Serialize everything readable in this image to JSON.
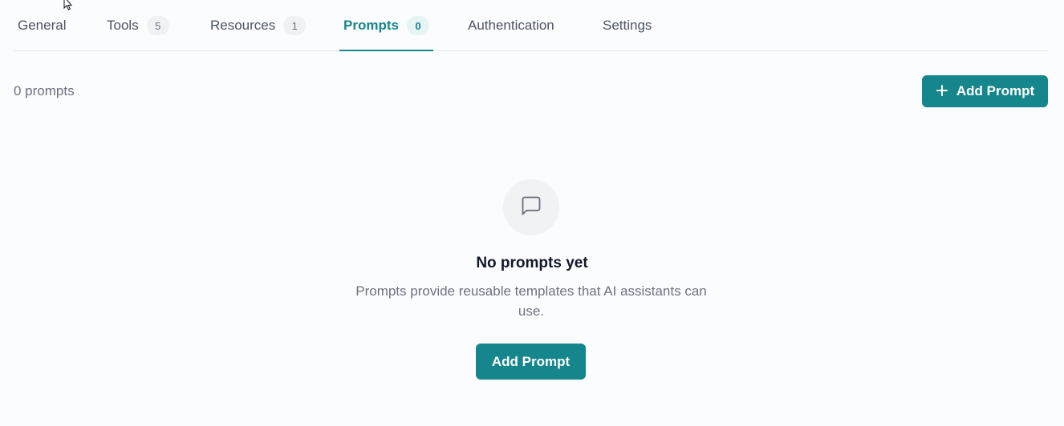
{
  "tabs": [
    {
      "label": "General"
    },
    {
      "label": "Tools",
      "badge": "5"
    },
    {
      "label": "Resources",
      "badge": "1"
    },
    {
      "label": "Prompts",
      "badge": "0",
      "active": true
    },
    {
      "label": "Authentication"
    },
    {
      "label": "Settings"
    }
  ],
  "toolbar": {
    "count_text": "0 prompts",
    "add_button_label": "Add Prompt",
    "add_button_icon": "plus-icon"
  },
  "empty_state": {
    "icon": "message-square-icon",
    "title": "No prompts yet",
    "description": "Prompts provide reusable templates that AI assistants can use.",
    "button_label": "Add Prompt"
  },
  "colors": {
    "accent": "#15868c",
    "background": "#fbfcfd",
    "muted_text": "#6b7280"
  }
}
